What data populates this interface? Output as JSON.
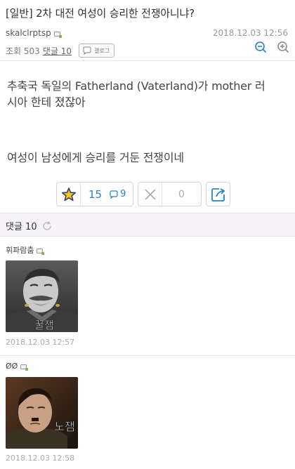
{
  "post": {
    "title": "[일반] 2차 대전 여성이 승리한 전쟁아니냐?",
    "author": "skalclrptsp",
    "date": "2018.12.03 12:56",
    "views_label": "조회 503",
    "comments_label": "댓글 10",
    "gallery_label": "갤로그",
    "body_line1": "추축국 독일의 Fatherland (Vaterland)가 mother 러",
    "body_line2": "시아 한테 졌잖아",
    "body_line3": "여성이 남성에게 승리를 거둔 전쟁이네"
  },
  "votes": {
    "up_count": "15",
    "comment_count": "9",
    "down_count": "0"
  },
  "comments": {
    "header": "댓글 10",
    "items": [
      {
        "author": "휘파람춤",
        "image_caption": "꿀잼",
        "date": "2018.12.03 12:57"
      },
      {
        "author": "ØØ",
        "image_caption": "노잼",
        "date": "2018.12.03 12:58"
      }
    ]
  },
  "colors": {
    "accent": "#2b82c9",
    "comment_header_bg": "#f6f3f8"
  },
  "icons": [
    "level-icon",
    "gallery-icon",
    "zoom-out-icon",
    "zoom-in-icon",
    "star-icon",
    "comment-icon",
    "close-icon",
    "share-icon",
    "refresh-icon"
  ]
}
